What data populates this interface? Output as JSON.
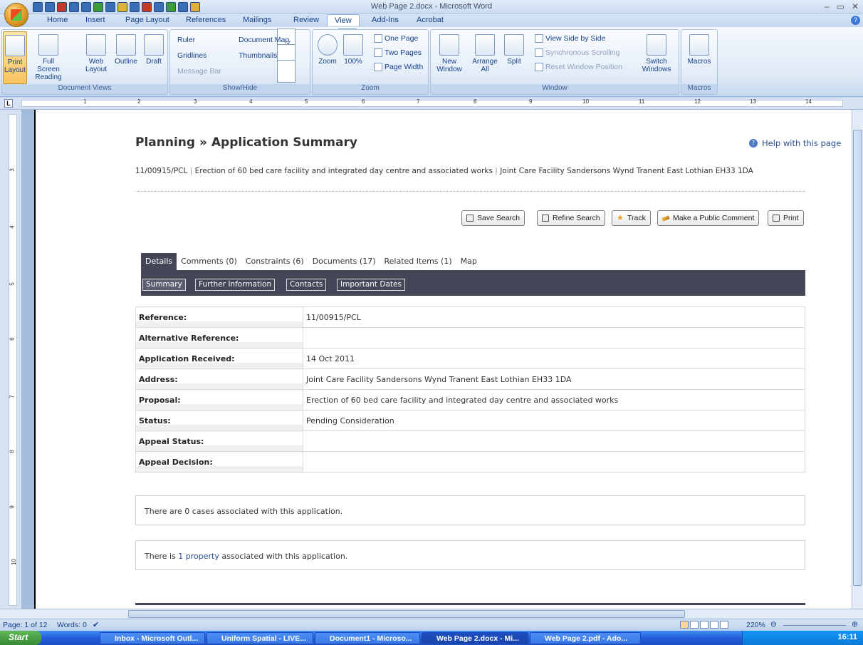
{
  "window": {
    "title": "Web Page 2.docx - Microsoft Word",
    "controls": [
      "–",
      "▭",
      "✕"
    ]
  },
  "ribbon_tabs": [
    "Home",
    "Insert",
    "Page Layout",
    "References",
    "Mailings",
    "Review",
    "View",
    "Add-Ins",
    "Acrobat"
  ],
  "active_tab": "View",
  "ribbon": {
    "document_views": {
      "label": "Document Views",
      "print_layout": "Print Layout",
      "full_screen": "Full Screen Reading",
      "web_layout": "Web Layout",
      "outline": "Outline",
      "draft": "Draft"
    },
    "show_hide": {
      "label": "Show/Hide",
      "ruler": "Ruler",
      "gridlines": "Gridlines",
      "message_bar": "Message Bar",
      "document_map": "Document Map",
      "thumbnails": "Thumbnails",
      "ruler_checked": true
    },
    "zoom": {
      "label": "Zoom",
      "zoom": "Zoom",
      "hundred": "100%",
      "one_page": "One Page",
      "two_pages": "Two Pages",
      "page_width": "Page Width"
    },
    "window": {
      "label": "Window",
      "new_window": "New Window",
      "arrange_all": "Arrange All",
      "split": "Split",
      "side_by_side": "View Side by Side",
      "sync_scrolling": "Synchronous Scrolling",
      "reset_position": "Reset Window Position",
      "switch_windows": "Switch Windows"
    },
    "macros": {
      "label": "Macros",
      "macros": "Macros"
    }
  },
  "ruler_numbers": [
    "1",
    "2",
    "3",
    "4",
    "5",
    "6",
    "7",
    "8",
    "9",
    "10",
    "11",
    "12",
    "13",
    "14"
  ],
  "vruler_numbers": [
    "3",
    "4",
    "5",
    "6",
    "7",
    "8",
    "9",
    "10"
  ],
  "webpage": {
    "title": "Planning » Application Summary",
    "help": "Help with this page",
    "reference": "11/00915/PCL",
    "proposal": "Erection of 60 bed care facility and integrated day centre and associated works",
    "address": "Joint Care Facility Sandersons Wynd Tranent East Lothian EH33 1DA",
    "sep": "|",
    "actions": [
      "Save Search",
      "Refine Search",
      "Track",
      "Make a Public Comment",
      "Print"
    ],
    "tabs": [
      "Details",
      "Comments (0)",
      "Constraints (6)",
      "Documents (17)",
      "Related Items (1)",
      "Map"
    ],
    "subnav": [
      "Summary",
      "Further Information",
      "Contacts",
      "Important Dates"
    ],
    "rows": [
      {
        "k": "Reference:",
        "v": "11/00915/PCL"
      },
      {
        "k": "Alternative Reference:",
        "v": ""
      },
      {
        "k": "Application Received:",
        "v": "14 Oct 2011"
      },
      {
        "k": "Address:",
        "v": "Joint Care Facility Sandersons Wynd Tranent East Lothian EH33 1DA"
      },
      {
        "k": "Proposal:",
        "v": "Erection of 60 bed care facility and integrated day centre and associated works"
      },
      {
        "k": "Status:",
        "v": "Pending Consideration"
      },
      {
        "k": "Appeal Status:",
        "v": ""
      },
      {
        "k": "Appeal Decision:",
        "v": ""
      }
    ],
    "cases_text": "There are 0 cases associated with this application.",
    "property_pre": "There is ",
    "property_link": "1 property",
    "property_post": " associated with this application."
  },
  "statusbar": {
    "page": "Page: 1 of 12",
    "words": "Words: 0",
    "zoom": "220%"
  },
  "taskbar": {
    "start": "Start",
    "tasks": [
      "Inbox - Microsoft Outl...",
      "Uniform Spatial - LIVE...",
      "Document1 - Microso...",
      "Web Page 2.docx - Mi...",
      "Web Page 2.pdf - Ado..."
    ],
    "active_task": 3,
    "clock": "16:11"
  }
}
